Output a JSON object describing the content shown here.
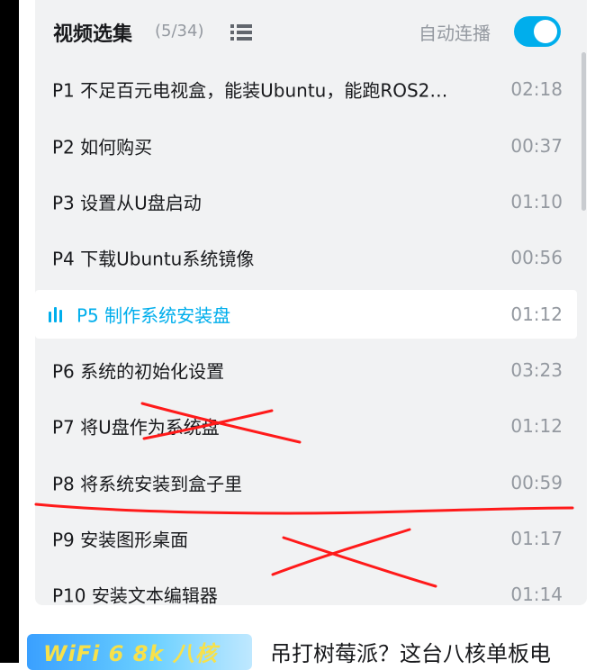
{
  "header": {
    "title": "视频选集",
    "count": "(5/34)",
    "autoplay_label": "自动连播",
    "autoplay_on": true
  },
  "episodes": [
    {
      "label": "P1   不足百元电视盒，能装Ubuntu，能跑ROS2…",
      "duration": "02:18"
    },
    {
      "label": "P2   如何购买",
      "duration": "00:37"
    },
    {
      "label": "P3   设置从U盘启动",
      "duration": "01:10"
    },
    {
      "label": "P4   下载Ubuntu系统镜像",
      "duration": "00:56"
    },
    {
      "label": "P5   制作系统安装盘",
      "duration": "01:12",
      "playing": true
    },
    {
      "label": "P6   系统的初始化设置",
      "duration": "03:23"
    },
    {
      "label": "P7   将U盘作为系统盘",
      "duration": "01:12"
    },
    {
      "label": "P8   将系统安装到盒子里",
      "duration": "00:59"
    },
    {
      "label": "P9   安装图形桌面",
      "duration": "01:17"
    },
    {
      "label": "P10   安装文本编辑器",
      "duration": "01:14"
    }
  ],
  "recommendation": {
    "thumb_text": "WiFi 6   8k 八核",
    "title": "吊打树莓派？这台八核单板电"
  },
  "colors": {
    "accent": "#00aeec",
    "annotation": "#ff1a1a",
    "panel_bg": "#f1f2f3"
  }
}
